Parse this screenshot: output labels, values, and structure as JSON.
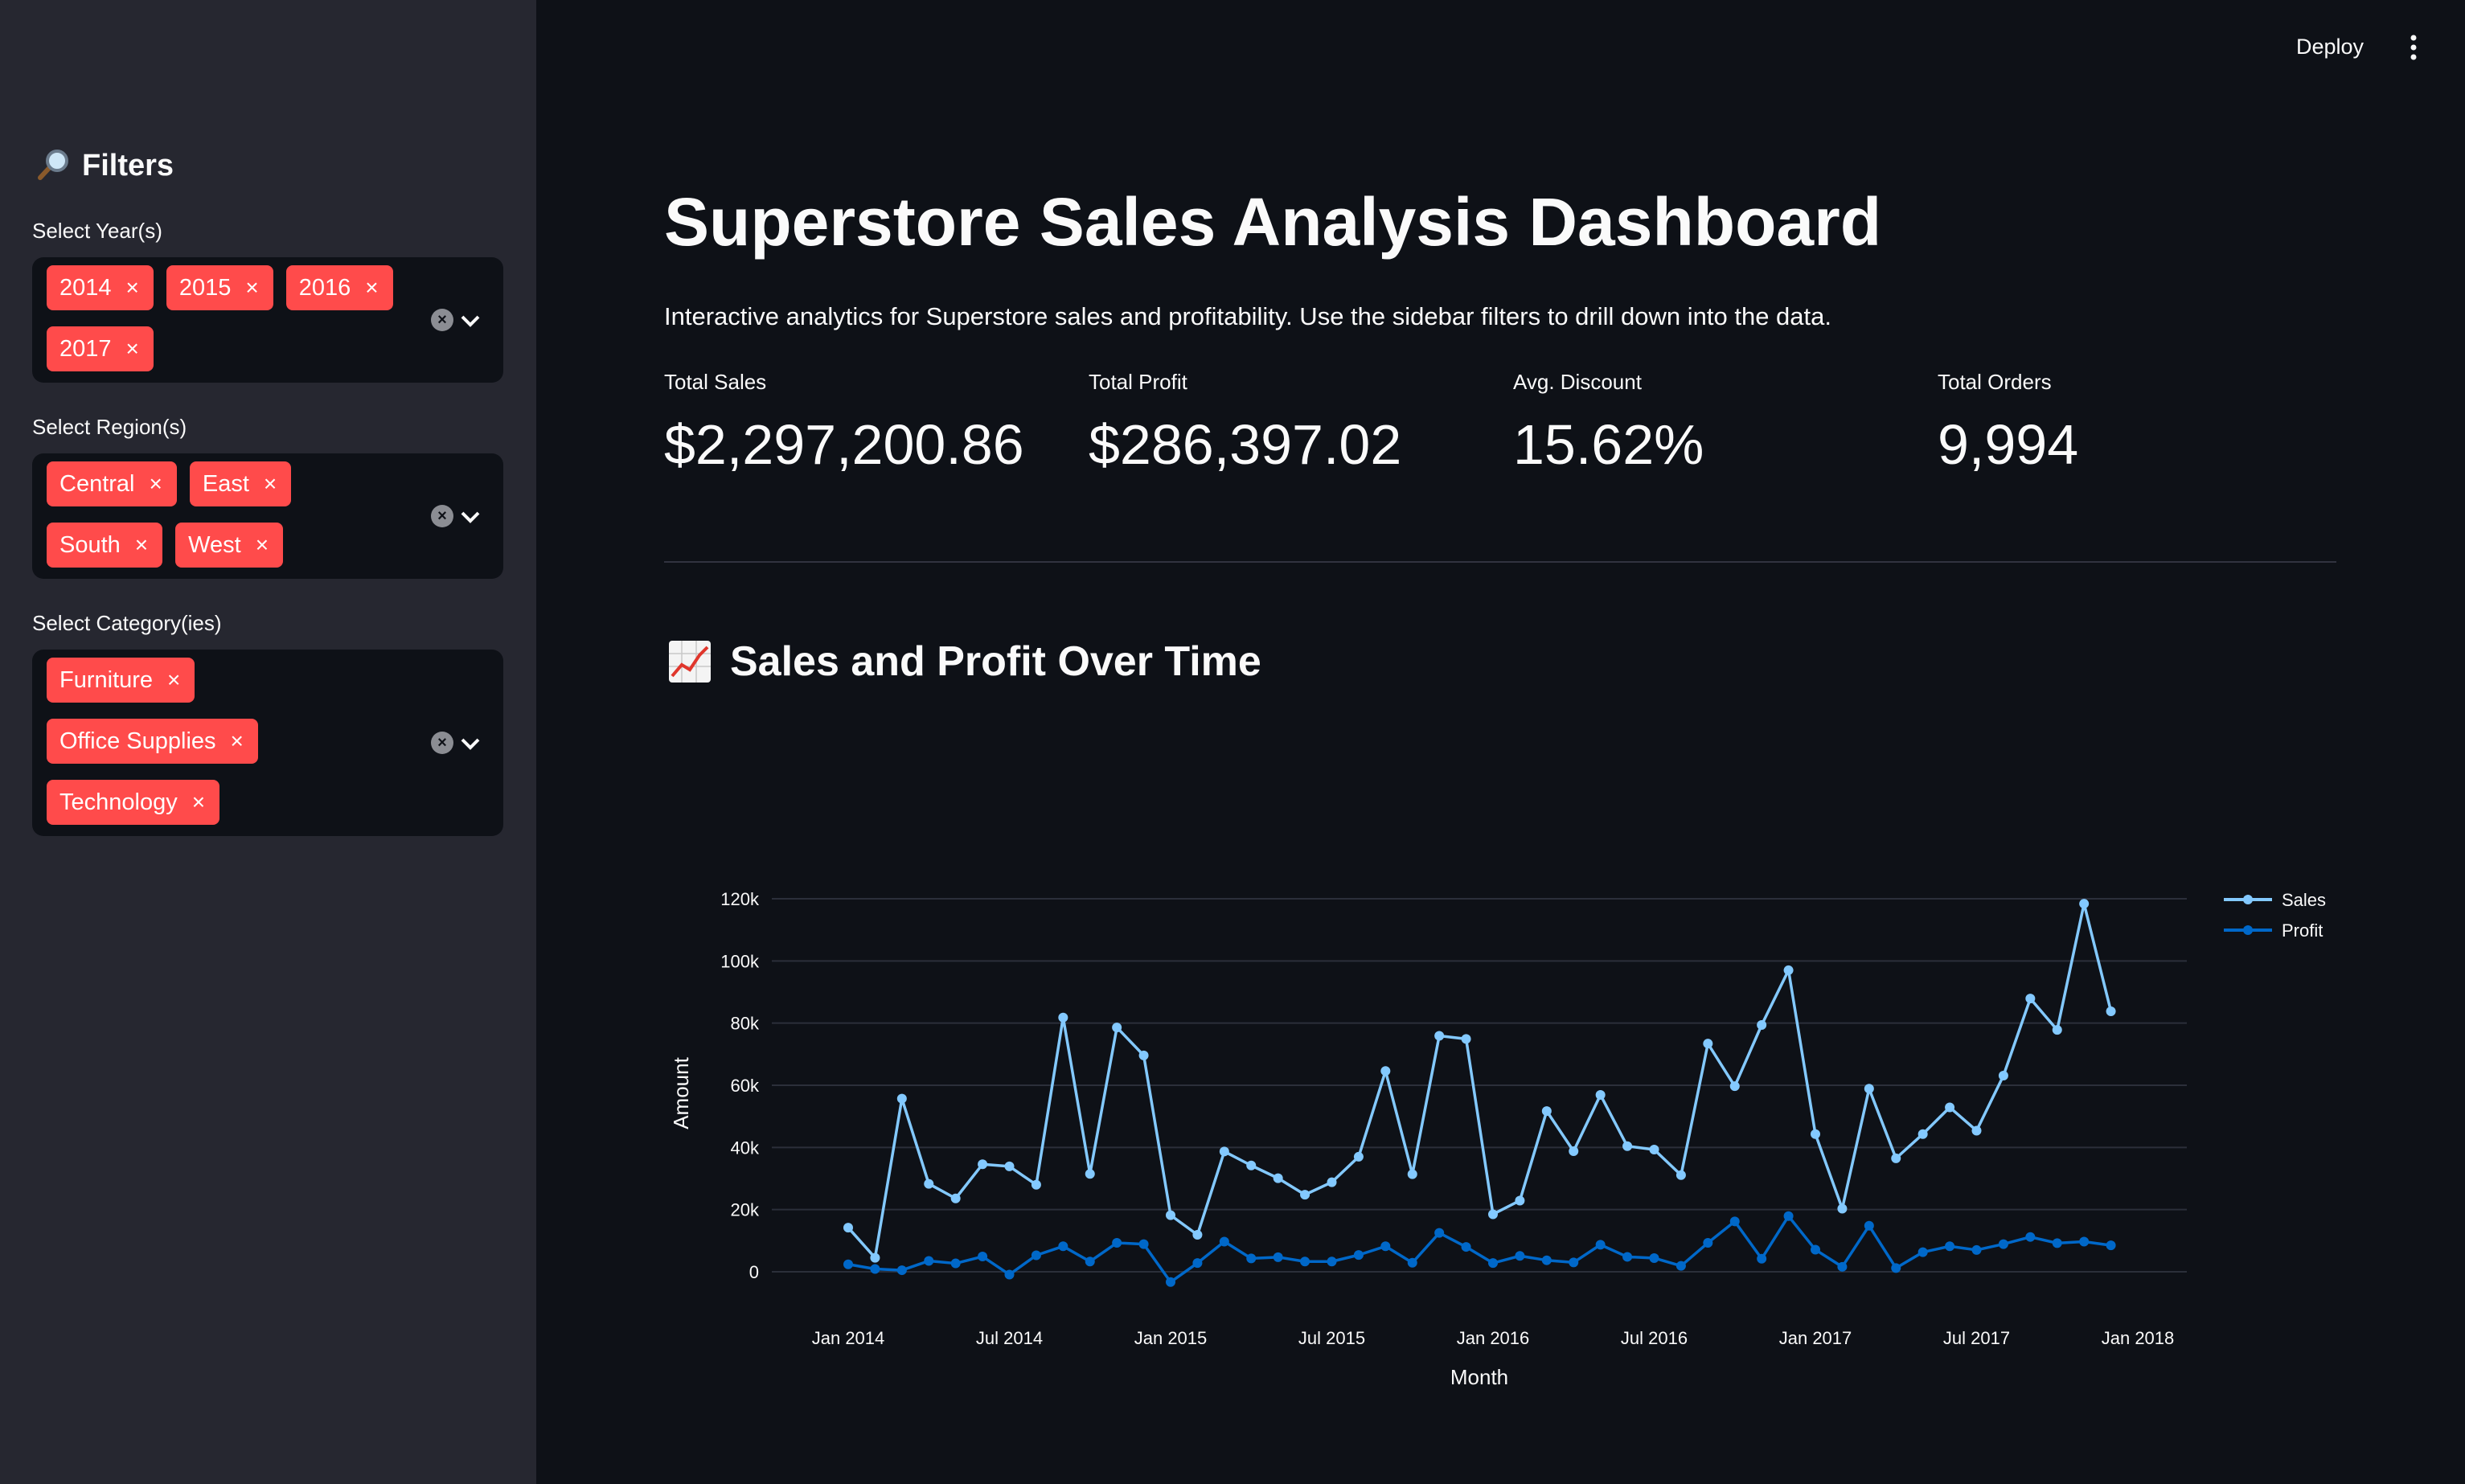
{
  "header": {
    "deploy_label": "Deploy",
    "menu_icon": "kebab-menu-icon"
  },
  "sidebar": {
    "title": "Filters",
    "title_icon": "magnifying-glass-icon",
    "filters": [
      {
        "label": "Select Year(s)",
        "selected": [
          "2014",
          "2015",
          "2016",
          "2017"
        ]
      },
      {
        "label": "Select Region(s)",
        "selected": [
          "Central",
          "East",
          "South",
          "West"
        ]
      },
      {
        "label": "Select Category(ies)",
        "selected": [
          "Furniture",
          "Office Supplies",
          "Technology"
        ]
      }
    ],
    "chip_remove_glyph": "×",
    "clear_glyph": "×",
    "chip_color": "#ff4b4b"
  },
  "main": {
    "title": "Superstore Sales Analysis Dashboard",
    "description": "Interactive analytics for Superstore sales and profitability. Use the sidebar filters to drill down into the data.",
    "metrics": [
      {
        "label": "Total Sales",
        "value": "$2,297,200.86"
      },
      {
        "label": "Total Profit",
        "value": "$286,397.02"
      },
      {
        "label": "Avg. Discount",
        "value": "15.62%"
      },
      {
        "label": "Total Orders",
        "value": "9,994"
      }
    ],
    "section_title": "Sales and Profit Over Time",
    "section_icon": "chart-increasing-icon"
  },
  "chart_data": {
    "type": "line",
    "xlabel": "Month",
    "ylabel": "Amount",
    "x_start": "2014-01",
    "x_ticks": [
      "Jan 2014",
      "Jul 2014",
      "Jan 2015",
      "Jul 2015",
      "Jan 2016",
      "Jul 2016",
      "Jan 2017",
      "Jul 2017",
      "Jan 2018"
    ],
    "y_ticks": [
      "0",
      "20k",
      "40k",
      "60k",
      "80k",
      "100k",
      "120k"
    ],
    "ylim": [
      0,
      120000
    ],
    "grid": true,
    "legend_position": "top-right",
    "series": [
      {
        "name": "Sales",
        "color": "#83c9ff",
        "values": [
          14200,
          4500,
          55700,
          28300,
          23600,
          34600,
          33900,
          28000,
          81800,
          31500,
          78600,
          69600,
          18200,
          11900,
          38700,
          34200,
          30100,
          24800,
          28800,
          37000,
          64600,
          31400,
          75900,
          74900,
          18500,
          22900,
          51700,
          38800,
          56900,
          40400,
          39300,
          31100,
          73400,
          59700,
          79400,
          97000,
          44300,
          20300,
          58900,
          36500,
          44300,
          52900,
          45400,
          63100,
          87900,
          77800,
          118400,
          83800
        ]
      },
      {
        "name": "Profit",
        "color": "#0068c9",
        "values": [
          2400,
          900,
          500,
          3500,
          2700,
          4900,
          -900,
          5300,
          8200,
          3300,
          9300,
          8900,
          -3300,
          2800,
          9700,
          4300,
          4700,
          3300,
          3300,
          5400,
          8200,
          2900,
          12500,
          8000,
          2800,
          5100,
          3700,
          3000,
          8700,
          4800,
          4400,
          1900,
          9300,
          16200,
          4200,
          17900,
          7100,
          1600,
          14800,
          1200,
          6300,
          8200,
          7000,
          8900,
          11200,
          9200,
          9700,
          8500
        ]
      }
    ]
  }
}
